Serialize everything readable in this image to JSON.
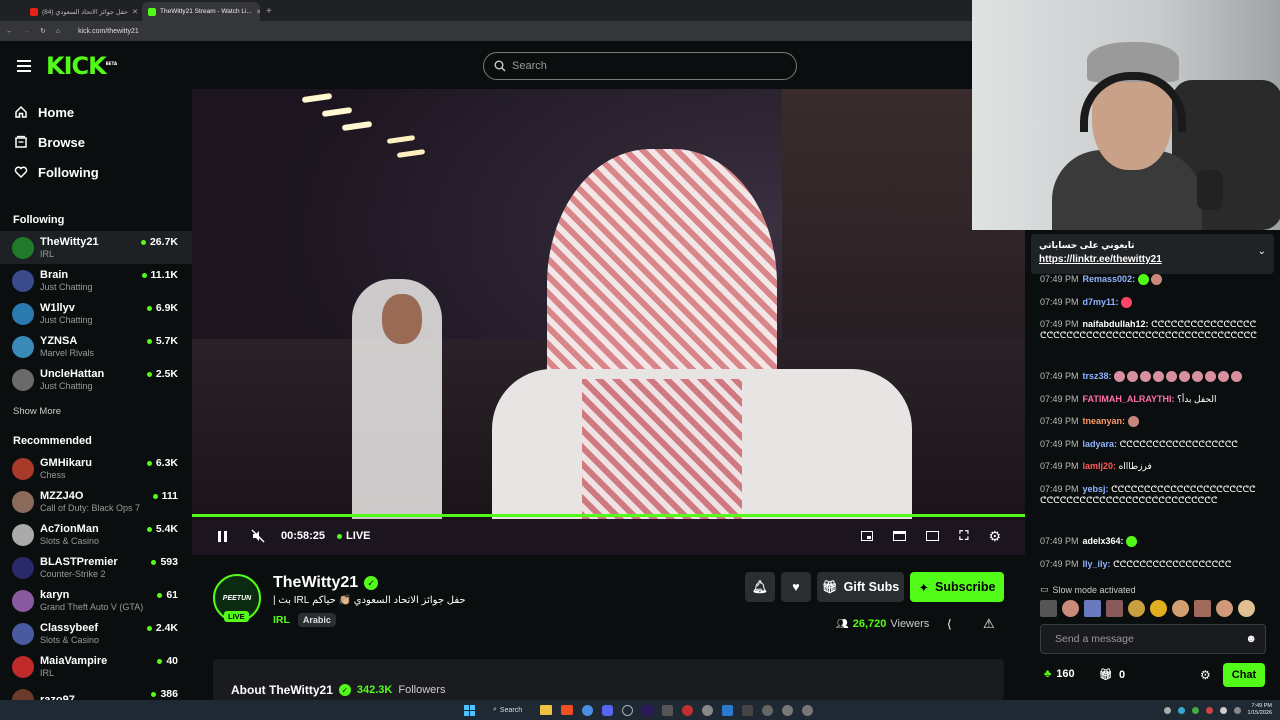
{
  "browser": {
    "tabs": [
      {
        "label": "(84) حفل جوائز الاتحاد السعودي"
      },
      {
        "label": "TheWitty21 Stream - Watch Li..."
      }
    ],
    "url": "kick.com/thewitty21"
  },
  "header": {
    "logo": "KICK",
    "logo_badge": "BETA",
    "search_placeholder": "Search"
  },
  "sidebar": {
    "nav": [
      {
        "label": "Home",
        "icon": "home-icon"
      },
      {
        "label": "Browse",
        "icon": "browse-icon"
      },
      {
        "label": "Following",
        "icon": "heart-icon"
      }
    ],
    "following_title": "Following",
    "following": [
      {
        "name": "TheWitty21",
        "category": "IRL",
        "viewers": "26.7K",
        "color": "#1f7a2a"
      },
      {
        "name": "Brain",
        "category": "Just Chatting",
        "viewers": "11.1K",
        "color": "#3a4a8a"
      },
      {
        "name": "W1llyv",
        "category": "Just Chatting",
        "viewers": "6.9K",
        "color": "#2a7ab0"
      },
      {
        "name": "YZNSA",
        "category": "Marvel Rivals",
        "viewers": "5.7K",
        "color": "#3a8ab8"
      },
      {
        "name": "UncleHattan",
        "category": "Just Chatting",
        "viewers": "2.5K",
        "color": "#6a6a6a"
      }
    ],
    "show_more": "Show More",
    "recommended_title": "Recommended",
    "recommended": [
      {
        "name": "GMHikaru",
        "category": "Chess",
        "viewers": "6.3K",
        "color": "#a83a2a"
      },
      {
        "name": "MZZJ4O",
        "category": "Call of Duty: Black Ops 7",
        "viewers": "111",
        "color": "#8a6a5a"
      },
      {
        "name": "Ac7ionMan",
        "category": "Slots & Casino",
        "viewers": "5.4K",
        "color": "#aaaaaa"
      },
      {
        "name": "BLASTPremier",
        "category": "Counter-Strike 2",
        "viewers": "593",
        "color": "#2a2a6a"
      },
      {
        "name": "karyn",
        "category": "Grand Theft Auto V (GTA)",
        "viewers": "61",
        "color": "#8a5aa0"
      },
      {
        "name": "Classybeef",
        "category": "Slots & Casino",
        "viewers": "2.4K",
        "color": "#4a5aa0"
      },
      {
        "name": "MaiaVampire",
        "category": "IRL",
        "viewers": "40",
        "color": "#c02a2a"
      },
      {
        "name": "razo97",
        "category": "",
        "viewers": "386",
        "color": "#6a3a2a"
      }
    ]
  },
  "player": {
    "time": "00:58:25",
    "live_label": "LIVE"
  },
  "stream": {
    "channel": "TheWitty21",
    "title": "حفل جوائز الاتحاد السعودي 👏🏼 حياكم IRL بث |",
    "category": "IRL",
    "language": "Arabic",
    "live_badge": "LIVE",
    "gift_label": "Gift Subs",
    "subscribe_label": "Subscribe",
    "viewers": "26,720",
    "viewers_label": "Viewers",
    "about_label": "About TheWitty21",
    "followers": "342.3K",
    "followers_label": "Followers"
  },
  "chat": {
    "pinned_text": "تابعوني على حساباتي",
    "pinned_link": "https://linktr.ee/thewitty21",
    "messages": [
      {
        "time": "07:49 PM",
        "user": "Remass002:",
        "color": "#8fb4ff",
        "text": ""
      },
      {
        "time": "07:49 PM",
        "user": "d7my11:",
        "color": "#8fb4ff",
        "text": ""
      },
      {
        "time": "07:49 PM",
        "user": "naifabdullah12:",
        "color": "#ffffff",
        "text": "ᕦᕦᕦᕦᕦᕦᕦᕦᕦᕦᕦᕦᕦᕦᕦᕦᕦᕦᕦᕦᕦᕦᕦᕦᕦᕦᕦᕦᕦᕦᕦᕦᕦᕦᕦᕦᕦᕦᕦᕦᕦᕦᕦᕦᕦᕦᕦᕦᕦ"
      },
      {
        "time": "07:49 PM",
        "user": "trsz38:",
        "color": "#8fb4ff",
        "text": ""
      },
      {
        "time": "07:49 PM",
        "user": "FATIMAH_ALRAYTHI:",
        "color": "#ff6fa8",
        "text": "الحفل بدأ؟"
      },
      {
        "time": "07:49 PM",
        "user": "tneanyan:",
        "color": "#ff9966",
        "text": ""
      },
      {
        "time": "07:49 PM",
        "user": "ladyara:",
        "color": "#8fb4ff",
        "text": "ᕦᕦᕦᕦᕦᕦᕦᕦᕦᕦᕦᕦᕦᕦᕦᕦᕦᕦ"
      },
      {
        "time": "07:49 PM",
        "user": "lamlj20:",
        "color": "#ff5a5a",
        "text": "فرزطاااه"
      },
      {
        "time": "07:49 PM",
        "user": "yebsj:",
        "color": "#8fb4ff",
        "text": "ᕦᕦᕦᕦᕦᕦᕦᕦᕦᕦᕦᕦᕦᕦᕦᕦᕦᕦᕦᕦᕦᕦᕦᕦᕦᕦᕦᕦᕦᕦᕦᕦᕦᕦᕦᕦᕦᕦᕦᕦᕦᕦᕦᕦᕦᕦᕦᕦᕦ"
      },
      {
        "time": "07:49 PM",
        "user": "adelx364:",
        "color": "#ffffff",
        "text": ""
      },
      {
        "time": "07:49 PM",
        "user": "lly_ily:",
        "color": "#8fb4ff",
        "text": "ᕦᕦᕦᕦᕦᕦᕦᕦᕦᕦᕦᕦᕦᕦᕦᕦᕦᕦ"
      }
    ],
    "slow_mode": "Slow mode activated",
    "input_placeholder": "Send a message",
    "points": "160",
    "gifts": "0",
    "chat_button": "Chat"
  },
  "taskbar": {
    "search": "Search",
    "time": "7:49 PM",
    "date": "1/15/2026"
  },
  "colors": {
    "accent": "#53fc18",
    "background": "#0b0e0f"
  }
}
